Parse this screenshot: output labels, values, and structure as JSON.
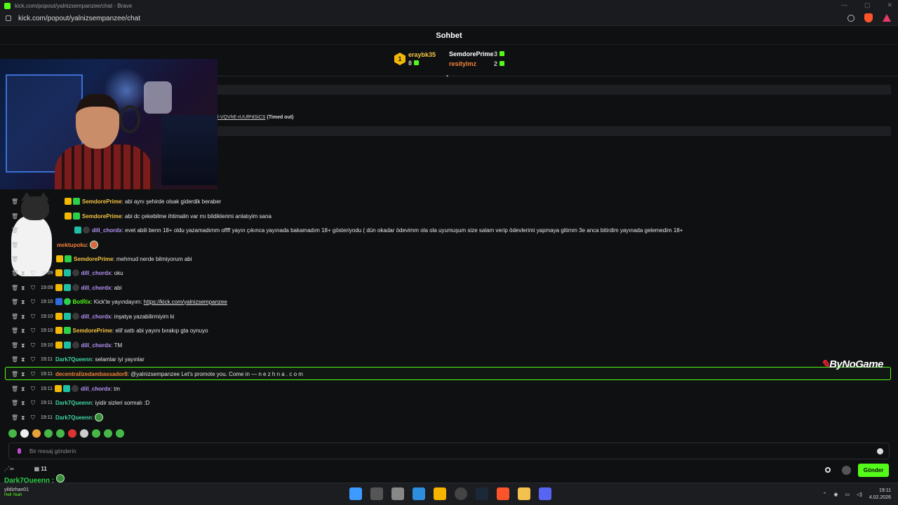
{
  "window": {
    "title": "kick.com/popout/yalnizsempanzee/chat - Brave",
    "url": "kick.com/popout/yalnizsempanzee/chat"
  },
  "chat": {
    "title": "Sohbet",
    "timeout_text": "l-VQVhE-rUUfPdSiCS",
    "timeout_label": "(Timed out)",
    "leaderboard": [
      {
        "rank": "1",
        "name": "eraybk35",
        "count": "8"
      },
      {
        "name": "SemdorePrime",
        "count": "3"
      },
      {
        "name": "resitylmz",
        "count": "2"
      }
    ],
    "messages": [
      {
        "time": "19:07",
        "user": "SemdorePrime",
        "text": "abi aynı şehirde olsak giderdik beraber"
      },
      {
        "time": "19:08",
        "user": "SemdorePrime",
        "text": "abi dc çekebilme ihtimalin var mı bildiklerimi anlatıyim sana"
      },
      {
        "time": "19:08",
        "user": "dill_chordx",
        "text": "evet abili benn 18+ oldu yazamadımm offff yayın çıkınca yayınada bakamadım 18+ gösteriyodu ( dün okadar ödevimm ola ola uyumuşum size salam verip ödevlerimi yapmaya gitimm 3e anca bitirdim yayınada gelemedim 18+"
      },
      {
        "time": "19:09",
        "user": "mektupoku",
        "text": ""
      },
      {
        "time": "19:09",
        "user": "SemdorePrime",
        "text": "mehmud nerde bilmiyorum abi"
      },
      {
        "time": "19:09",
        "user": "dill_chordx",
        "text": "oku"
      },
      {
        "time": "19:09",
        "user": "dill_chordx",
        "text": "abi"
      },
      {
        "time": "19:10",
        "user": "BotRix",
        "text": "Kick'te yayındayım:",
        "link": "https://kick.com/yalnizsempanzee"
      },
      {
        "time": "19:10",
        "user": "dill_chordx",
        "text": "inşatya yazabilirmiyim ki"
      },
      {
        "time": "19:10",
        "user": "SemdorePrime",
        "text": "elif sattı abi yayını bırakıp gta oynuyo"
      },
      {
        "time": "19:10",
        "user": "dill_chordx",
        "text": "TM"
      },
      {
        "time": "19:11",
        "user": "Dark7Queenn",
        "text": "selamlar iyi yayınlar"
      },
      {
        "time": "19:11",
        "user": "decentralizedambassador8",
        "text": "@yalnizsempanzee Let's promote you. Come in — n e z h n a . c o m"
      },
      {
        "time": "19:11",
        "user": "dill_chordx",
        "text": "tm"
      },
      {
        "time": "19:11",
        "user": "Dark7Queenn",
        "text": "iyidir sizleri sormalı :D"
      },
      {
        "time": "19:11",
        "user": "Dark7Queenn",
        "text": ""
      }
    ],
    "input_placeholder": "Bir mesaj gönderin",
    "send_label": "Gönder",
    "bottom_count": "11",
    "bottom_user": "Dark7Queenn",
    "watermark": "ByNoGame"
  },
  "taskbar": {
    "user": "yildizhan01",
    "user_sub": "Hell Yeah",
    "time": "19:11",
    "date": "4.02.2026"
  }
}
